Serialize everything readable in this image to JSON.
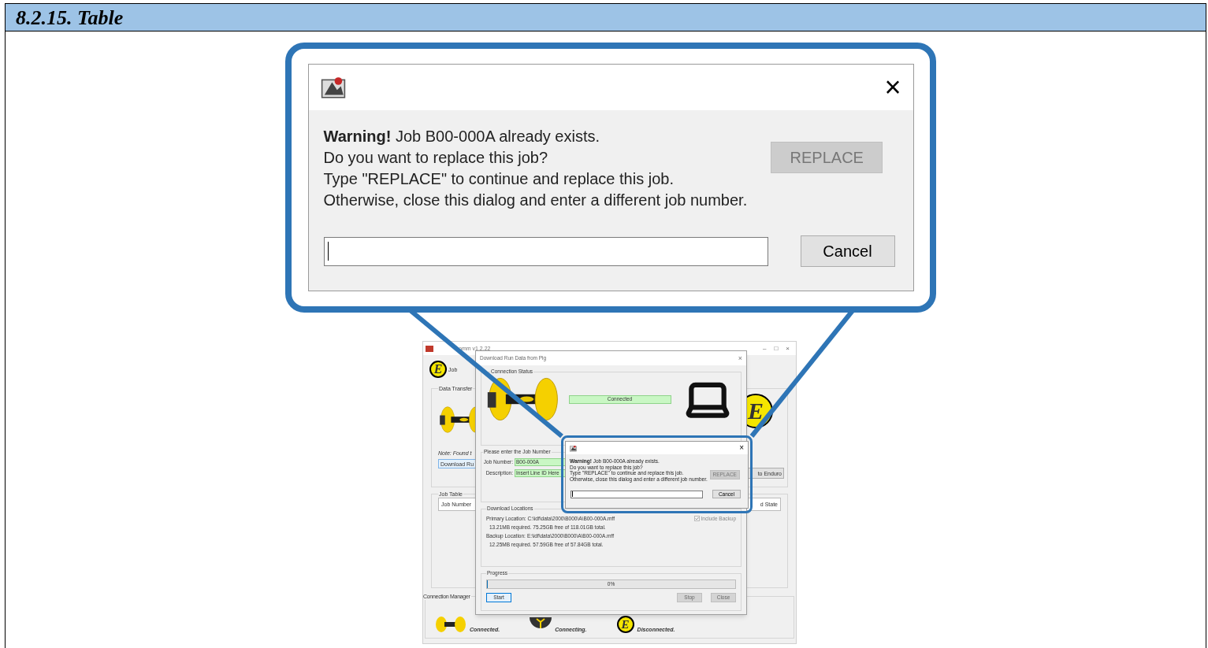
{
  "heading": "8.2.15. Table",
  "zoomed_dialog": {
    "close_label": "×",
    "message": [
      "**Warning!** Job B00-000A already exists.",
      "Do you want to replace this job?",
      "Type \"REPLACE\" to continue and replace this job.",
      "Otherwise, close this dialog and enter a different job number."
    ],
    "replace_button": {
      "label": "REPLACE",
      "disabled": true
    },
    "cancel_button": {
      "label": "Cancel",
      "disabled": false
    }
  },
  "app_window": {
    "title": "omm v1.2.22",
    "controls": [
      "–",
      "□",
      "×"
    ],
    "header_logo": "E",
    "header": "Job",
    "data_transfer": {
      "title": "Data Transfer",
      "note_label": "Note:",
      "note": "Found t",
      "download_button": "Download Ru",
      "logo": "E",
      "goto_button": "to Enduro"
    },
    "job_table": {
      "title": "Job Table",
      "columns": [
        "Job Number",
        "d State"
      ]
    },
    "connection_manager": {
      "title": "Connection Manager",
      "items": [
        {
          "kind": "pig",
          "label": "Connected."
        },
        {
          "kind": "receiver",
          "label": "Connecting."
        },
        {
          "kind": "logo",
          "logo": "E",
          "label": "Disconnected."
        }
      ]
    }
  },
  "download_dialog": {
    "title": "Download Run Data from Pig",
    "close_label": "×",
    "connection_status": {
      "title": "Connection Status",
      "status": "Connected"
    },
    "job_group": {
      "title": "Please enter the Job Number",
      "fields": [
        {
          "label": "Job Number:",
          "value": "B00-000A"
        },
        {
          "label": "Description:",
          "value": "Insert Line ID Here"
        }
      ]
    },
    "locations": {
      "title": "Download Locations",
      "rows": [
        {
          "label": "Primary Location:",
          "path": "C:\\idf\\data\\2000\\B000\\A\\B00-000A.mff",
          "info": "13.21MB required. 75.25GB free of 118.01GB total."
        },
        {
          "label": "Backup Location:",
          "path": "E:\\idf\\data\\2000\\B000\\A\\B00-000A.mff",
          "info": "12.25MB required. 57.59GB free of 57.84GB total."
        }
      ],
      "include_backup": {
        "label": "Include Backup",
        "checked": true,
        "disabled": true
      }
    },
    "progress": {
      "title": "Progress",
      "level": 0,
      "reading": "0%",
      "buttons": [
        {
          "label": "Start",
          "disabled": false
        },
        {
          "label": "Stop",
          "disabled": true
        },
        {
          "label": "Close",
          "disabled": true
        }
      ]
    }
  },
  "small_dialog": {
    "close_label": "×",
    "message": [
      "**Warning!** Job B00-000A already exists.",
      "Do you want to replace this job?",
      "Type \"REPLACE\" to continue and replace this job.",
      "Otherwise, close this dialog and enter a different job number."
    ],
    "replace_button": {
      "label": "REPLACE",
      "disabled": true
    },
    "cancel_button": {
      "label": "Cancel",
      "disabled": false
    }
  }
}
